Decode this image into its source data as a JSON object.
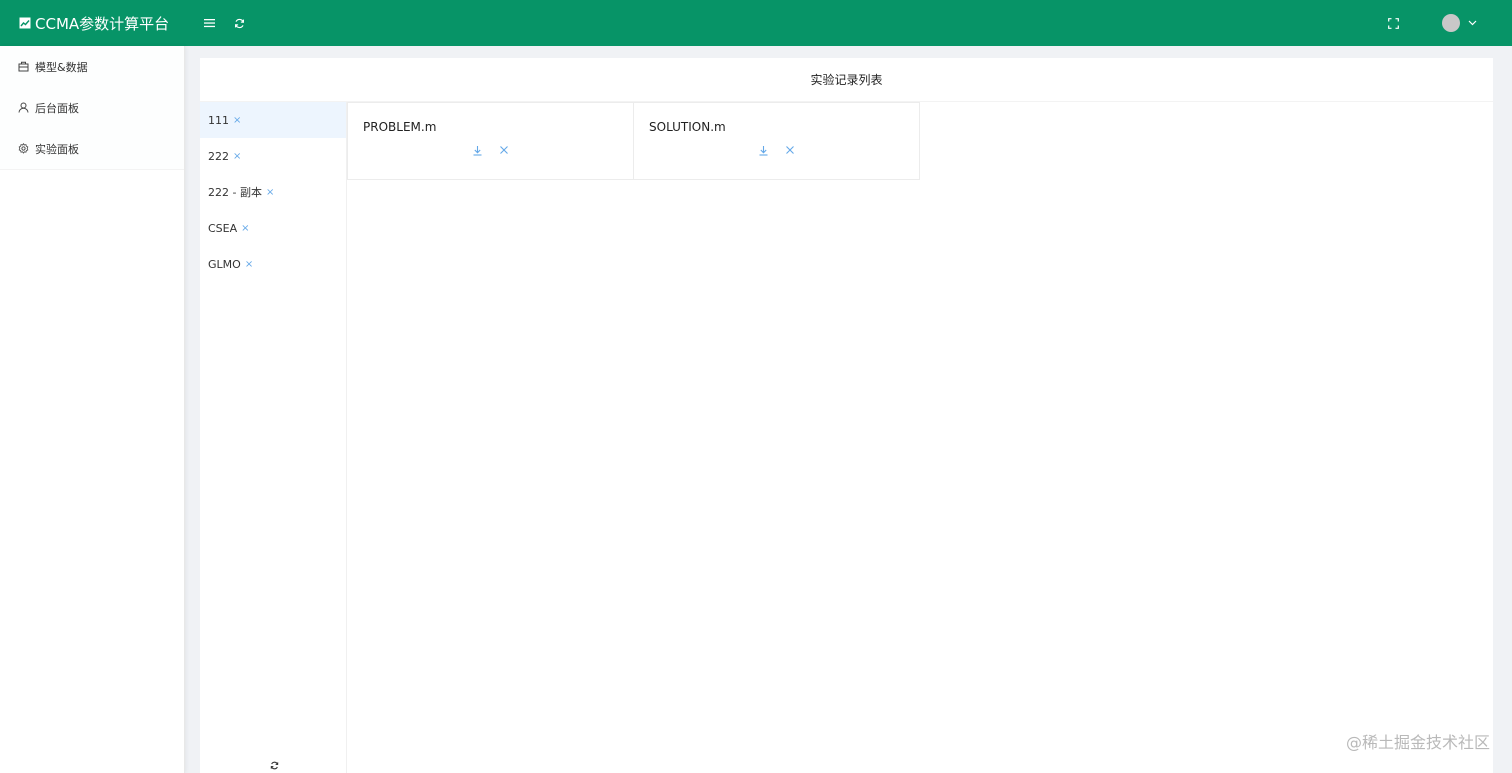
{
  "header": {
    "app_title": "CCMA参数计算平台",
    "icons": [
      "chart-icon",
      "menu-toggle-icon",
      "refresh-icon",
      "fullscreen-icon",
      "avatar",
      "chevron-down-icon"
    ]
  },
  "sidebar": {
    "items": [
      {
        "label": "模型&数据",
        "icon": "package-icon"
      },
      {
        "label": "后台面板",
        "icon": "user-icon"
      },
      {
        "label": "实验面板",
        "icon": "gear-icon"
      }
    ]
  },
  "main": {
    "title": "实验记录列表",
    "records": [
      {
        "label": "111",
        "active": true
      },
      {
        "label": "222",
        "active": false
      },
      {
        "label": "222 - 副本",
        "active": false
      },
      {
        "label": "CSEA",
        "active": false
      },
      {
        "label": "GLMO",
        "active": false
      }
    ],
    "remove_glyph": "×",
    "files": [
      {
        "name": "PROBLEM.m"
      },
      {
        "name": "SOLUTION.m"
      }
    ]
  },
  "watermark": "@稀土掘金技术社区",
  "colors": {
    "header_bg": "#079467",
    "active_row_bg": "#edf5fe",
    "action_icon": "#64a8e8"
  }
}
